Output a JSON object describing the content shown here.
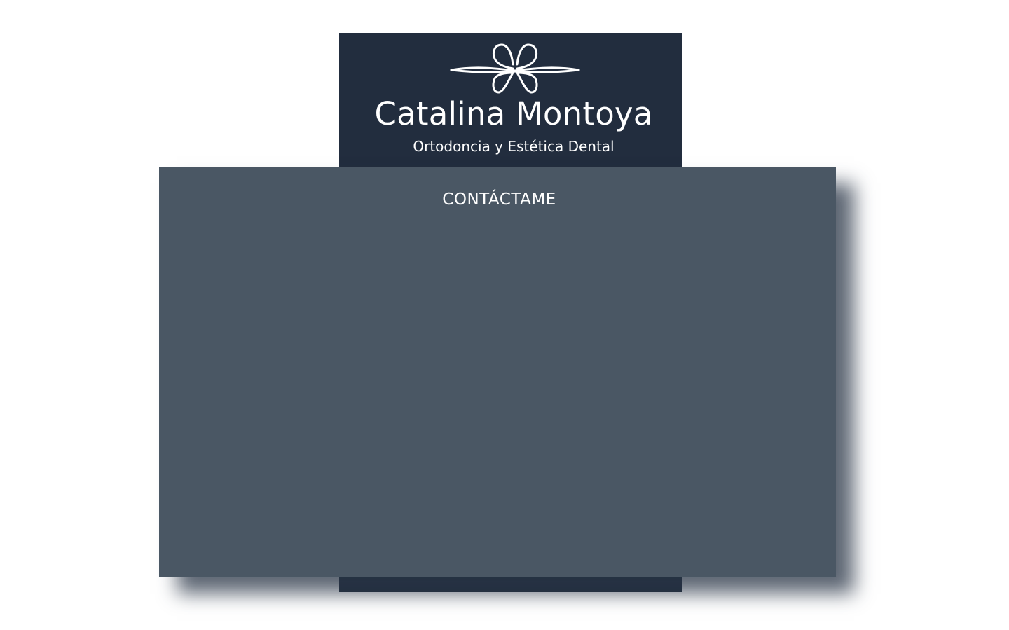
{
  "brand": {
    "logo_icon": "teeth-bow-icon",
    "name": "Catalina Montoya",
    "tagline": "Ortodoncia y Estética Dental"
  },
  "contact_panel": {
    "title": "CONTÁCTAME"
  },
  "colors": {
    "page_background": "#ffffff",
    "brand_block": "#222d3e",
    "panel_background": "#4a5764",
    "text": "#ffffff"
  }
}
